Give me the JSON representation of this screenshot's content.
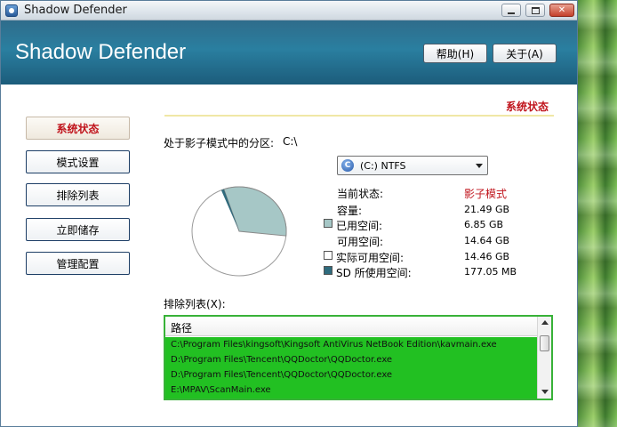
{
  "window": {
    "title": "Shadow Defender"
  },
  "banner": {
    "title": "Shadow Defender",
    "help_label": "帮助(H)",
    "about_label": "关于(A)"
  },
  "section": {
    "heading": "系统状态"
  },
  "nav": {
    "items": [
      {
        "label": "系统状态",
        "active": true
      },
      {
        "label": "模式设置",
        "active": false
      },
      {
        "label": "排除列表",
        "active": false
      },
      {
        "label": "立即储存",
        "active": false
      },
      {
        "label": "管理配置",
        "active": false
      }
    ]
  },
  "partition": {
    "label": "处于影子模式中的分区:",
    "value": "C:\\",
    "dropdown_value": "(C:) NTFS"
  },
  "stats": {
    "status_label": "当前状态:",
    "status_value": "影子模式",
    "capacity_label": "容量:",
    "capacity_value": "21.49 GB",
    "used_label": "已用空间:",
    "used_value": "6.85 GB",
    "free_label": "可用空间:",
    "free_value": "14.64 GB",
    "actual_free_label": "实际可用空间:",
    "actual_free_value": "14.46 GB",
    "sd_used_label": "SD 所使用空间:",
    "sd_used_value": "177.05 MB"
  },
  "pie_data": {
    "capacity_gb": 21.49,
    "used_gb": 6.85,
    "sd_used_gb": 0.177,
    "colors": {
      "used": "#a6c7c6",
      "sd": "#2f6b7d",
      "free": "#ffffff"
    }
  },
  "exclusion": {
    "label": "排除列表(X):",
    "column_header": "路径",
    "rows": [
      "C:\\Program Files\\kingsoft\\Kingsoft AntiVirus NetBook Edition\\kavmain.exe",
      "D:\\Program Files\\Tencent\\QQDoctor\\QQDoctor.exe",
      "D:\\Program Files\\Tencent\\QQDoctor\\QQDoctor.exe",
      "E:\\MPAV\\ScanMain.exe"
    ]
  }
}
